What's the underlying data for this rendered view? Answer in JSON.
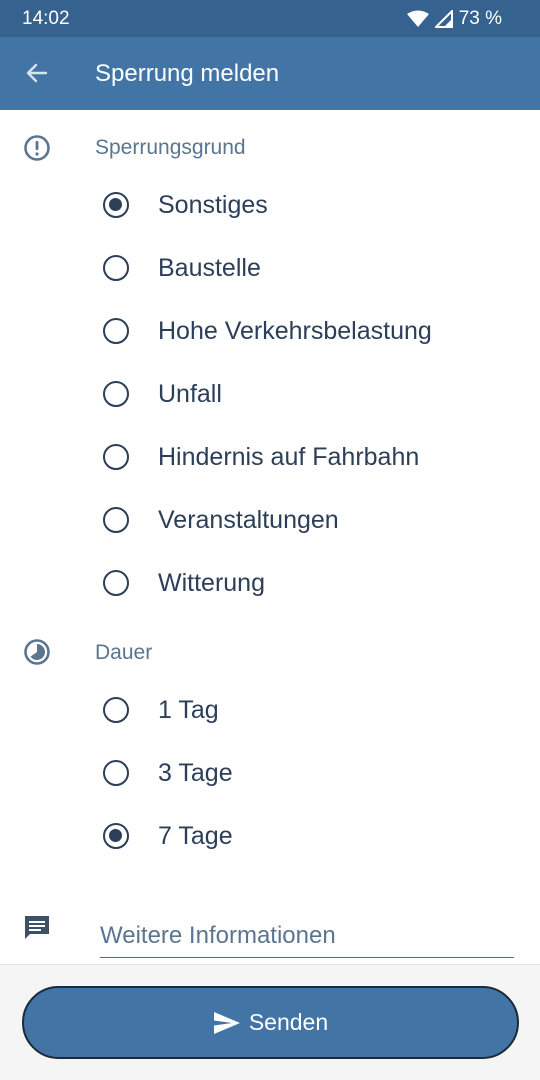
{
  "status_bar": {
    "time": "14:02",
    "battery": "73 %"
  },
  "app_bar": {
    "title": "Sperrung melden"
  },
  "reason_section": {
    "header": "Sperrungsgrund",
    "options": [
      {
        "label": "Sonstiges",
        "checked": true
      },
      {
        "label": "Baustelle",
        "checked": false
      },
      {
        "label": "Hohe Verkehrsbelastung",
        "checked": false
      },
      {
        "label": "Unfall",
        "checked": false
      },
      {
        "label": "Hindernis auf Fahrbahn",
        "checked": false
      },
      {
        "label": "Veranstaltungen",
        "checked": false
      },
      {
        "label": "Witterung",
        "checked": false
      }
    ]
  },
  "duration_section": {
    "header": "Dauer",
    "options": [
      {
        "label": "1 Tag",
        "checked": false
      },
      {
        "label": "3 Tage",
        "checked": false
      },
      {
        "label": "7 Tage",
        "checked": true
      }
    ]
  },
  "info_field": {
    "placeholder": "Weitere Informationen",
    "value": ""
  },
  "send_button": {
    "label": "Senden"
  }
}
